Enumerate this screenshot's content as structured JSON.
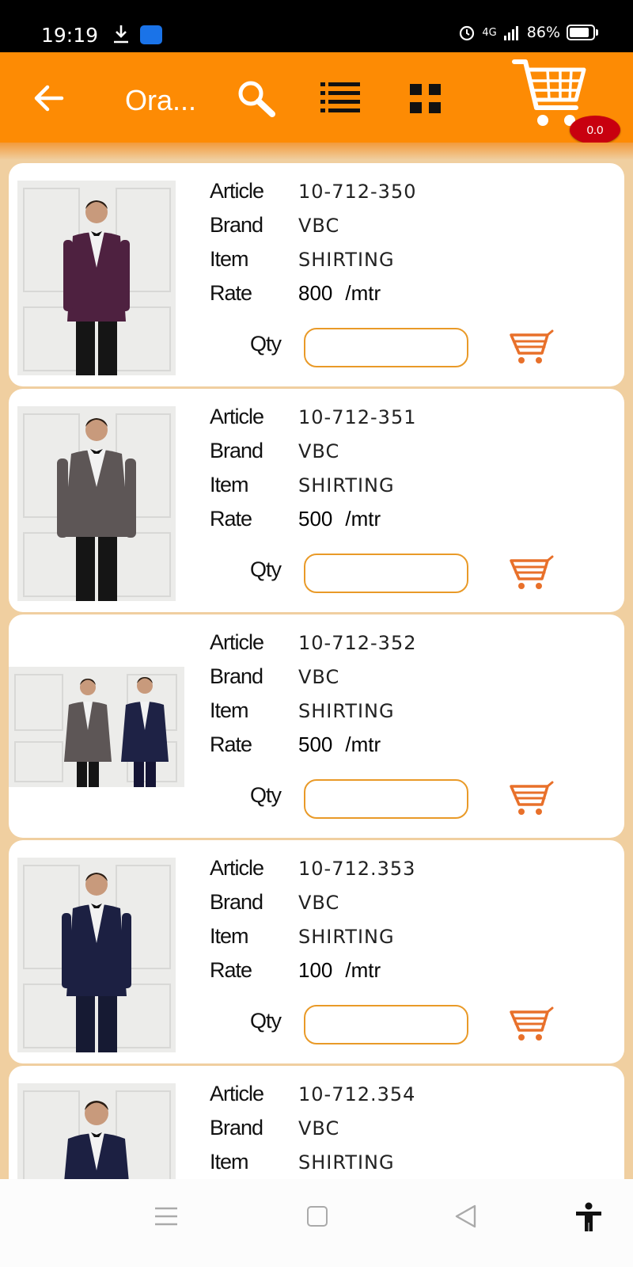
{
  "status": {
    "time": "19:19",
    "battery": "86%",
    "network": "4G",
    "battery_level": 0.86
  },
  "toolbar": {
    "title": "Ora...",
    "cart_total": "0.0"
  },
  "labels": {
    "article": "Article",
    "brand": "Brand",
    "item": "Item",
    "rate": "Rate",
    "qty": "Qty",
    "unit": "/mtr"
  },
  "products": [
    {
      "article": "10-712-350",
      "brand": "VBC",
      "item": "SHIRTING",
      "rate": "800",
      "unit": "/mtr"
    },
    {
      "article": "10-712-351",
      "brand": "VBC",
      "item": "SHIRTING",
      "rate": "500",
      "unit": "/mtr"
    },
    {
      "article": "10-712-352",
      "brand": "VBC",
      "item": "SHIRTING",
      "rate": "500",
      "unit": "/mtr"
    },
    {
      "article": "10-712.353",
      "brand": "VBC",
      "item": "SHIRTING",
      "rate": "100",
      "unit": "/mtr"
    },
    {
      "article": "10-712.354",
      "brand": "VBC",
      "item": "SHIRTING",
      "rate": "",
      "unit": ""
    }
  ],
  "colors": {
    "accent": "#fd8b04",
    "background": "#f0cfa0",
    "cart_icon": "#e8702a",
    "badge": "#c8000f"
  },
  "icons": {
    "back": "arrow-left-icon",
    "search": "search-icon",
    "list": "list-view-icon",
    "grid": "grid-view-icon",
    "cart": "shopping-cart-icon",
    "add_to_cart": "add-to-cart-icon"
  }
}
